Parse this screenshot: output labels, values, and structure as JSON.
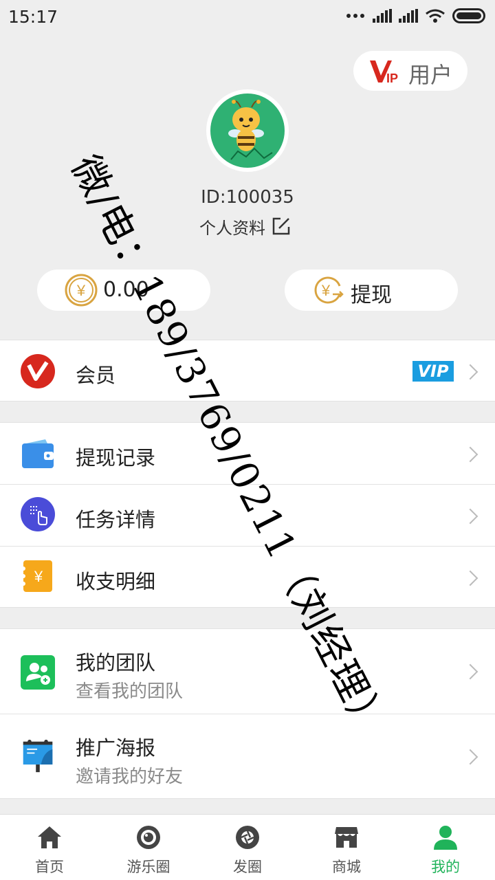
{
  "status_bar": {
    "time": "15:17"
  },
  "header": {
    "vip_user_label": "用户",
    "user_id": "ID:100035",
    "profile_link": "个人资料",
    "balance": "0.00",
    "withdraw_label": "提现"
  },
  "menu": {
    "member": {
      "label": "会员",
      "badge": "VIP"
    },
    "withdraw_records": {
      "label": "提现记录"
    },
    "task_details": {
      "label": "任务详情"
    },
    "income_details": {
      "label": "收支明细"
    },
    "my_team": {
      "label": "我的团队",
      "sub": "查看我的团队"
    },
    "poster": {
      "label": "推广海报",
      "sub": "邀请我的好友"
    }
  },
  "tabbar": {
    "items": [
      {
        "label": "首页",
        "icon": "home-icon"
      },
      {
        "label": "游乐圈",
        "icon": "circle-camera-icon"
      },
      {
        "label": "发圈",
        "icon": "aperture-icon"
      },
      {
        "label": "商城",
        "icon": "store-icon"
      },
      {
        "label": "我的",
        "icon": "user-icon",
        "active": true
      }
    ]
  },
  "watermark": "微/电：189/3769/0211（刘经理）",
  "colors": {
    "accent": "#20b35a",
    "vip_blue": "#1a9de0",
    "vip_red": "#d7281e"
  }
}
